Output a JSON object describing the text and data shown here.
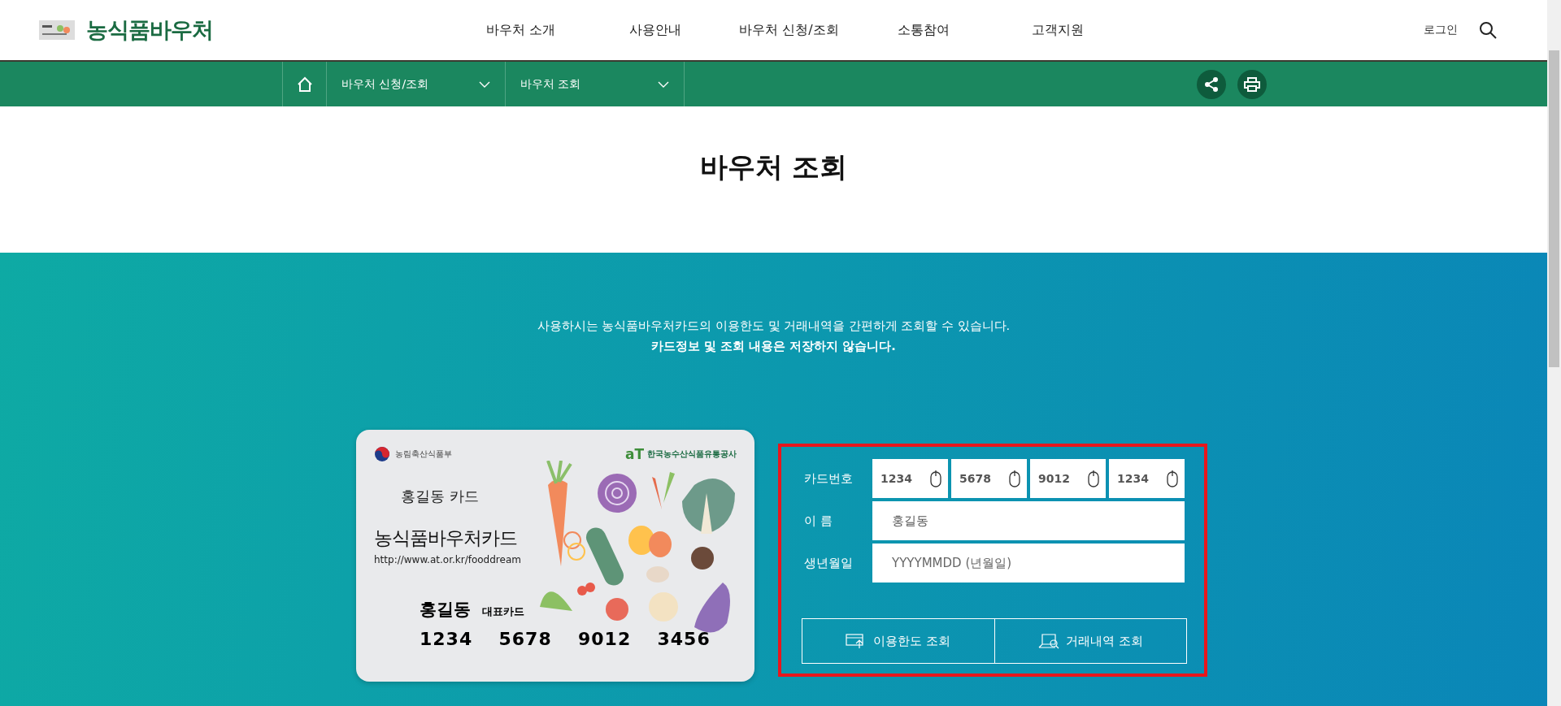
{
  "header": {
    "logo": "농식품바우처",
    "nav": [
      {
        "label": "바우처 소개"
      },
      {
        "label": "사용안내"
      },
      {
        "label": "바우처 신청/조회"
      },
      {
        "label": "소통참여"
      },
      {
        "label": "고객지원"
      }
    ],
    "login": "로그인"
  },
  "breadcrumb": {
    "items": [
      {
        "label": "바우처 신청/조회"
      },
      {
        "label": "바우처 조회"
      }
    ]
  },
  "page_title": "바우처 조회",
  "intro": {
    "line1": "사용하시는 농식품바우처카드의 이용한도 및 거래내역을 간편하게 조회할 수 있습니다.",
    "line2": "카드정보 및 조회 내용은 저장하지 않습니다."
  },
  "card": {
    "ministry": "농림축산식품부",
    "agency": "한국농수산식품유통공사",
    "agency_mark": "aT",
    "owner_card": "홍길동 카드",
    "card_name": "농식품바우처카드",
    "url": "http://www.at.or.kr/fooddream",
    "holder": "홍길동",
    "holder_tag": "대표카드",
    "numbers": [
      "1234",
      "5678",
      "9012",
      "3456"
    ]
  },
  "form": {
    "card_label": "카드번호",
    "card_fields": [
      {
        "value": "1234"
      },
      {
        "value": "5678"
      },
      {
        "value": "9012"
      },
      {
        "value": "1234"
      }
    ],
    "name_label": "이 름",
    "name_value": "홍길동",
    "birth_label": "생년월일",
    "birth_placeholder": "YYYYMMDD (년월일)",
    "buttons": [
      {
        "label": "이용한도 조회",
        "kind": "limit"
      },
      {
        "label": "거래내역 조회",
        "kind": "history"
      }
    ]
  }
}
